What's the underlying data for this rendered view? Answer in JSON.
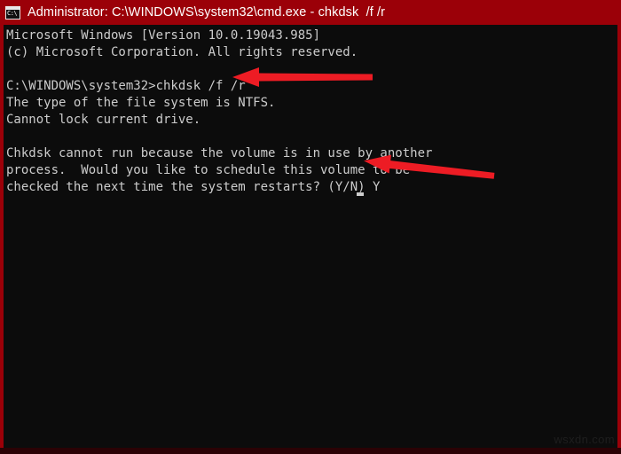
{
  "window": {
    "title": "Administrator: C:\\WINDOWS\\system32\\cmd.exe - chkdsk  /f /r",
    "icon_name": "cmd-icon",
    "icon_glyph": "C:\\",
    "title_bar_color": "#9b0008",
    "terminal_background": "#0c0c0c",
    "terminal_foreground": "#cccccc"
  },
  "console": {
    "lines": [
      "Microsoft Windows [Version 10.0.19043.985]",
      "(c) Microsoft Corporation. All rights reserved.",
      "",
      "C:\\WINDOWS\\system32>chkdsk /f /r",
      "The type of the file system is NTFS.",
      "Cannot lock current drive.",
      "",
      "Chkdsk cannot run because the volume is in use by another",
      "process.  Would you like to schedule this volume to be",
      "checked the next time the system restarts? (Y/N) Y"
    ],
    "text": "Microsoft Windows [Version 10.0.19043.985]\n(c) Microsoft Corporation. All rights reserved.\n\nC:\\WINDOWS\\system32>chkdsk /f /r\nThe type of the file system is NTFS.\nCannot lock current drive.\n\nChkdsk cannot run because the volume is in use by another\nprocess.  Would you like to schedule this volume to be\nchecked the next time the system restarts? (Y/N) Y",
    "command_entered": "chkdsk /f /r",
    "prompt": "C:\\WINDOWS\\system32>",
    "answer_typed": "Y",
    "cursor": "block"
  },
  "annotations": {
    "color": "#ed1c24",
    "arrows": [
      {
        "name": "arrow-command",
        "points_to": "chkdsk /f /r command line",
        "direction": "left"
      },
      {
        "name": "arrow-prompt",
        "points_to": "(Y/N) Y answer and cursor",
        "direction": "up-left"
      }
    ]
  },
  "watermark": {
    "text": "wsxdn.com"
  }
}
